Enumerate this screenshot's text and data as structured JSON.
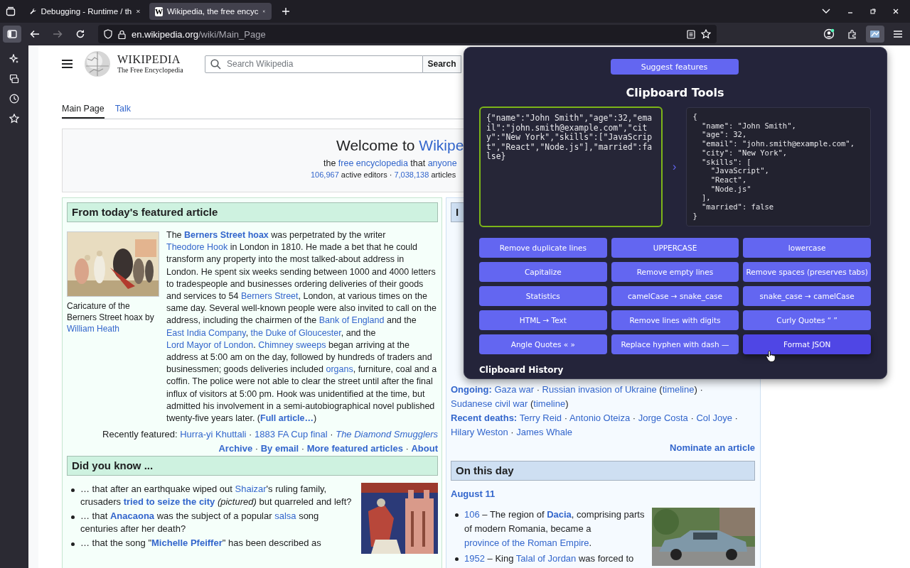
{
  "browser": {
    "tabs": [
      {
        "kind": "tool",
        "title": "Debugging - Runtime / th",
        "selected": false
      },
      {
        "kind": "wiki",
        "favicon": "W",
        "title": "Wikipedia, the free encyc",
        "selected": true
      }
    ],
    "url": {
      "domain": "en.wikipedia.org",
      "path": "/wiki/Main_Page"
    },
    "sidebar_open": true,
    "forward_enabled": false,
    "extension_active": true
  },
  "wiki": {
    "logo": {
      "wordmark": "WIKIPEDIA",
      "tagline": "The Free Encyclopedia"
    },
    "search": {
      "placeholder": "Search Wikipedia",
      "button": "Search"
    },
    "tabs": [
      {
        "label": "Main Page",
        "selected": true
      },
      {
        "label": "Talk",
        "selected": false
      }
    ],
    "welcome": {
      "title": [
        {
          "kind": "text",
          "text": "Welcome to "
        },
        {
          "kind": "link",
          "text": "Wikipe"
        }
      ],
      "line1": [
        {
          "kind": "text",
          "text": "the "
        },
        {
          "kind": "link",
          "text": "free encyclopedia"
        },
        {
          "kind": "text",
          "text": " that "
        },
        {
          "kind": "link",
          "text": "anyone"
        }
      ],
      "line2": [
        {
          "kind": "link",
          "text": "106,967"
        },
        {
          "kind": "text",
          "text": " active editors · "
        },
        {
          "kind": "link",
          "text": "7,038,138"
        },
        {
          "kind": "text",
          "text": " articles"
        }
      ]
    },
    "featured": {
      "heading": "From today's featured article",
      "caption": [
        {
          "kind": "text",
          "text": "Caricature of the Berners Street hoax by "
        },
        {
          "kind": "link",
          "text": "William Heath"
        }
      ],
      "body": [
        {
          "kind": "text",
          "text": "The "
        },
        {
          "kind": "bold_link",
          "text": "Berners Street hoax"
        },
        {
          "kind": "text",
          "text": " was perpetrated by the writer "
        },
        {
          "kind": "link",
          "text": "Theodore Hook"
        },
        {
          "kind": "text",
          "text": " in London in 1810. He made a bet that he could transform any property into the most talked-about address in London. He spent six weeks sending between 1000 and 4000 letters to tradespeople and businesses ordering deliveries of their goods and services to 54 "
        },
        {
          "kind": "link",
          "text": "Berners Street"
        },
        {
          "kind": "text",
          "text": ", London, at various times on the same day. Several well-known people were also invited to call on the address, including the chairmen of the "
        },
        {
          "kind": "link",
          "text": "Bank of England"
        },
        {
          "kind": "text",
          "text": " and the "
        },
        {
          "kind": "link",
          "text": "East India Company"
        },
        {
          "kind": "text",
          "text": ", "
        },
        {
          "kind": "link",
          "text": "the Duke of Gloucester"
        },
        {
          "kind": "text",
          "text": ", and the "
        },
        {
          "kind": "link",
          "text": "Lord Mayor of London"
        },
        {
          "kind": "text",
          "text": ". "
        },
        {
          "kind": "link",
          "text": "Chimney sweeps"
        },
        {
          "kind": "text",
          "text": " began arriving at the address at 5:00 am on the day, followed by hundreds of traders and businessmen; goods deliveries included "
        },
        {
          "kind": "link",
          "text": "organs"
        },
        {
          "kind": "text",
          "text": ", furniture, coal and a coffin. The police were not able to clear the street until after the final influx of visitors at 5:00 pm. Hook was unidentified at the time, but admitted his involvement in a semi-autobiographical novel published twenty-five years later. ("
        },
        {
          "kind": "bold_link",
          "text": "Full article…"
        },
        {
          "kind": "text",
          "text": ")"
        }
      ],
      "recent": [
        {
          "kind": "text",
          "text": "Recently featured: "
        },
        {
          "kind": "link",
          "text": "Hurra-yi Khuttali"
        },
        {
          "kind": "text",
          "text": " · "
        },
        {
          "kind": "link",
          "text": "1883 FA Cup final"
        },
        {
          "kind": "text",
          "text": " · "
        },
        {
          "kind": "italic_link",
          "text": "The Diamond Smugglers"
        }
      ],
      "more": [
        {
          "kind": "bold_link",
          "text": "Archive"
        },
        {
          "kind": "text",
          "text": " · "
        },
        {
          "kind": "bold_link",
          "text": "By email"
        },
        {
          "kind": "text",
          "text": " · "
        },
        {
          "kind": "bold_link",
          "text": "More featured articles"
        },
        {
          "kind": "text",
          "text": " · "
        },
        {
          "kind": "bold_link",
          "text": "About"
        }
      ]
    },
    "dyk": {
      "heading": "Did you know ...",
      "items": [
        [
          {
            "kind": "text",
            "text": "… that after an earthquake wiped out "
          },
          {
            "kind": "link",
            "text": "Shaizar"
          },
          {
            "kind": "text",
            "text": "'s ruling family, crusaders "
          },
          {
            "kind": "bold_link",
            "text": "tried to seize the city"
          },
          {
            "kind": "italic",
            "text": " (pictured)"
          },
          {
            "kind": "text",
            "text": " but quarreled and left?"
          }
        ],
        [
          {
            "kind": "text",
            "text": "… that "
          },
          {
            "kind": "bold_link",
            "text": "Anacaona"
          },
          {
            "kind": "text",
            "text": " was the subject of a popular "
          },
          {
            "kind": "link",
            "text": "salsa"
          },
          {
            "kind": "text",
            "text": " song centuries after her death?"
          }
        ],
        [
          {
            "kind": "text",
            "text": "… that the song \""
          },
          {
            "kind": "bold_link",
            "text": "Michelle Pfeiffer"
          },
          {
            "kind": "text",
            "text": "\" has been described as"
          }
        ]
      ]
    },
    "news": {
      "heading": "I",
      "ongoing": [
        {
          "kind": "bold_link",
          "text": "Ongoing: "
        },
        {
          "kind": "link",
          "text": "Gaza war"
        },
        {
          "kind": "text",
          "text": " · "
        },
        {
          "kind": "link",
          "text": "Russian invasion of Ukraine"
        },
        {
          "kind": "text",
          "text": " ("
        },
        {
          "kind": "link",
          "text": "timeline"
        },
        {
          "kind": "text",
          "text": ") · "
        },
        {
          "kind": "link",
          "text": "Sudanese civil war"
        },
        {
          "kind": "text",
          "text": " ("
        },
        {
          "kind": "link",
          "text": "timeline"
        },
        {
          "kind": "text",
          "text": ")"
        }
      ],
      "deaths": [
        {
          "kind": "bold_link",
          "text": "Recent deaths: "
        },
        {
          "kind": "link",
          "text": "Terry Reid"
        },
        {
          "kind": "text",
          "text": " · "
        },
        {
          "kind": "link",
          "text": "Antonio Oteiza"
        },
        {
          "kind": "text",
          "text": " · "
        },
        {
          "kind": "link",
          "text": "Jorge Costa"
        },
        {
          "kind": "text",
          "text": " · "
        },
        {
          "kind": "link",
          "text": "Col Joye"
        },
        {
          "kind": "text",
          "text": " · "
        },
        {
          "kind": "link",
          "text": "Hilary Weston"
        },
        {
          "kind": "text",
          "text": " · "
        },
        {
          "kind": "link",
          "text": "James Whale"
        }
      ],
      "nominate": "Nominate an article"
    },
    "otd": {
      "heading": "On this day",
      "date": "August 11",
      "items": [
        [
          {
            "kind": "link",
            "text": "106"
          },
          {
            "kind": "text",
            "text": " – The region of "
          },
          {
            "kind": "bold_link",
            "text": "Dacia"
          },
          {
            "kind": "text",
            "text": ", comprising parts of modern Romania, became a "
          },
          {
            "kind": "link",
            "text": "province of the Roman Empire"
          },
          {
            "kind": "text",
            "text": "."
          }
        ],
        [
          {
            "kind": "link",
            "text": "1952"
          },
          {
            "kind": "text",
            "text": " – King "
          },
          {
            "kind": "link",
            "text": "Talal of Jordan"
          },
          {
            "kind": "text",
            "text": " was forced to"
          }
        ]
      ]
    }
  },
  "clipboard": {
    "suggest": "Suggest features",
    "title": "Clipboard Tools",
    "input": "{\"name\":\"John Smith\",\"age\":32,\"email\":\"john.smith@example.com\",\"city\":\"New York\",\"skills\":[\"JavaScript\",\"React\",\"Node.js\"],\"married\":false}",
    "output": "{\n  \"name\": \"John Smith\",\n  \"age\": 32,\n  \"email\": \"john.smith@example.com\",\n  \"city\": \"New York\",\n  \"skills\": [\n    \"JavaScript\",\n    \"React\",\n    \"Node.js\"\n  ],\n  \"married\": false\n}",
    "arrow": "›",
    "buttons": [
      {
        "label": "Remove duplicate lines",
        "hovered": false
      },
      {
        "label": "UPPERCASE",
        "hovered": false
      },
      {
        "label": "lowercase",
        "hovered": false
      },
      {
        "label": "Capitalize",
        "hovered": false
      },
      {
        "label": "Remove empty lines",
        "hovered": false
      },
      {
        "label": "Remove spaces (preserves tabs)",
        "hovered": false
      },
      {
        "label": "Statistics",
        "hovered": false
      },
      {
        "label": "camelCase → snake_case",
        "hovered": false
      },
      {
        "label": "snake_case → camelCase",
        "hovered": false
      },
      {
        "label": "HTML → Text",
        "hovered": false
      },
      {
        "label": "Remove lines with digits",
        "hovered": false
      },
      {
        "label": "Curly Quotes “ ”",
        "hovered": false
      },
      {
        "label": "Angle Quotes « »",
        "hovered": false
      },
      {
        "label": "Replace hyphen with dash —",
        "hovered": false
      },
      {
        "label": "Format JSON",
        "hovered": true
      }
    ],
    "history_title": "Clipboard History"
  }
}
